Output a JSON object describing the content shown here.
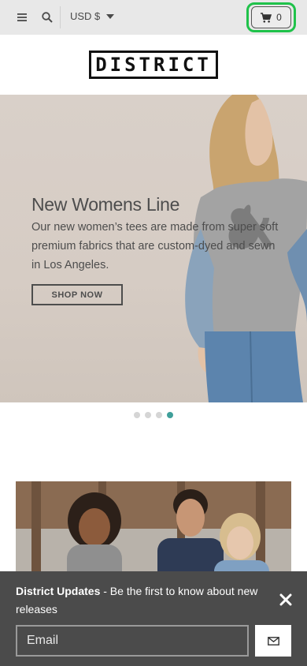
{
  "header": {
    "currency": "USD $",
    "cart_count": "0",
    "icons": [
      "menu-icon",
      "search-icon",
      "chevron-down-icon",
      "cart-icon"
    ],
    "cart_highlight_color": "#1fc24a"
  },
  "logo": {
    "text": "DISTRICT"
  },
  "hero": {
    "title": "New Womens Line",
    "body": "Our new women’s tees are made from super soft premium fabrics that are custom-dyed and sewn in Los Angeles.",
    "button_label": "SHOP NOW"
  },
  "carousel": {
    "slide_count": 4,
    "active_index": 3,
    "active_color": "#3f9f9a"
  },
  "newsletter": {
    "title": "District Updates",
    "text": " - Be the first to know about new releases",
    "email_placeholder": "Email",
    "icons": [
      "close-icon",
      "mail-icon"
    ]
  }
}
